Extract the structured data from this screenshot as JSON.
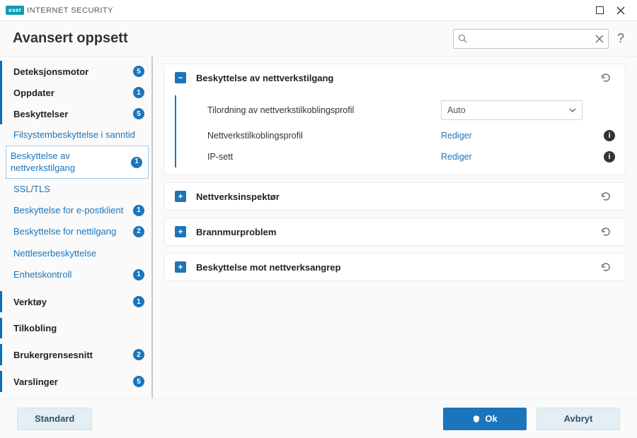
{
  "title_bar": {
    "brand_badge": "eset",
    "brand_text": "INTERNET SECURITY"
  },
  "header": {
    "title": "Avansert oppsett",
    "search_placeholder": ""
  },
  "sidebar": {
    "items": [
      {
        "label": "Deteksjonsmotor",
        "badge": "5",
        "top": true
      },
      {
        "label": "Oppdater",
        "badge": "1",
        "top": true
      },
      {
        "label": "Beskyttelser",
        "badge": "5",
        "top": true
      },
      {
        "label": "Filsystembeskyttelse i sanntid",
        "sub": true
      },
      {
        "label": "Beskyttelse av nettverkstilgang",
        "badge": "1",
        "sub": true,
        "selected": true
      },
      {
        "label": "SSL/TLS",
        "sub": true
      },
      {
        "label": "Beskyttelse for e-postklient",
        "badge": "1",
        "sub": true
      },
      {
        "label": "Beskyttelse for nettilgang",
        "badge": "2",
        "sub": true
      },
      {
        "label": "Nettleserbeskyttelse",
        "sub": true
      },
      {
        "label": "Enhetskontroll",
        "badge": "1",
        "sub": true
      },
      {
        "label": "Verktøy",
        "badge": "1",
        "top": true
      },
      {
        "label": "Tilkobling",
        "top": true
      },
      {
        "label": "Brukergrensesnitt",
        "badge": "2",
        "top": true
      },
      {
        "label": "Varslinger",
        "badge": "5",
        "top": true
      }
    ]
  },
  "content": {
    "panels": [
      {
        "title": "Beskyttelse av nettverkstilgang",
        "expanded": true,
        "rows": [
          {
            "label": "Tilordning av nettverkstilkoblingsprofil",
            "control": "dropdown",
            "value": "Auto"
          },
          {
            "label": "Nettverkstilkoblingsprofil",
            "control": "link",
            "value": "Rediger",
            "info": true
          },
          {
            "label": "IP-sett",
            "control": "link",
            "value": "Rediger",
            "info": true
          }
        ]
      },
      {
        "title": "Nettverksinspektør",
        "expanded": false
      },
      {
        "title": "Brannmurproblem",
        "expanded": false
      },
      {
        "title": "Beskyttelse mot nettverksangrep",
        "expanded": false
      }
    ]
  },
  "footer": {
    "default_btn": "Standard",
    "ok_btn": "Ok",
    "cancel_btn": "Avbryt"
  }
}
